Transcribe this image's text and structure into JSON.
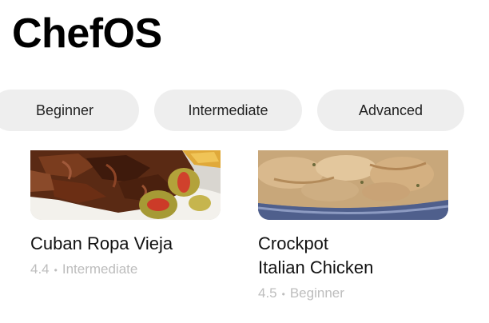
{
  "app": {
    "title": "ChefOS"
  },
  "filters": [
    {
      "label": "Beginner"
    },
    {
      "label": "Intermediate"
    },
    {
      "label": "Advanced"
    }
  ],
  "recipes": [
    {
      "title": "Cuban Ropa Vieja",
      "rating": "4.4",
      "level": "Intermediate",
      "image": "shredded-beef-with-olives-photo"
    },
    {
      "title": "Crockpot Italian Chicken",
      "title_line1": "Crockpot",
      "title_line2": "Italian Chicken",
      "rating": "4.5",
      "level": "Beginner",
      "image": "creamy-chicken-in-crockpot-photo"
    }
  ],
  "separator": "•"
}
